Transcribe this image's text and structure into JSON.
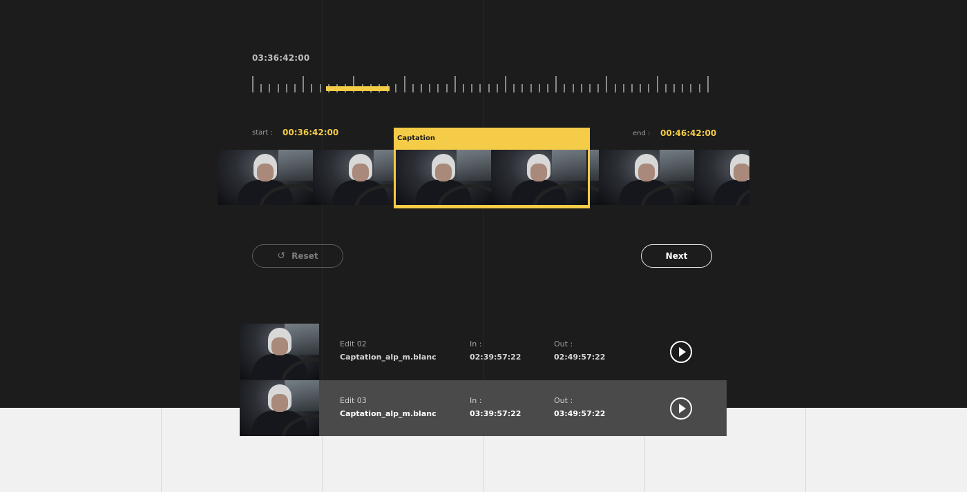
{
  "timeline": {
    "current_time": "03:36:42:00",
    "start_label": "start :",
    "start_value": "00:36:42:00",
    "end_label": "end :",
    "end_value": "00:46:42:00"
  },
  "selection": {
    "title": "Captation"
  },
  "buttons": {
    "reset_label": "Reset",
    "next_label": "Next"
  },
  "edits": [
    {
      "title": "Edit 02",
      "name": "Captation_alp_m.blanc",
      "in_label": "In :",
      "in_value": "02:39:57:22",
      "out_label": "Out :",
      "out_value": "02:49:57:22"
    },
    {
      "title": "Edit 03",
      "name": "Captation_alp_m.blanc",
      "in_label": "In :",
      "in_value": "03:39:57:22",
      "out_label": "Out :",
      "out_value": "03:49:57:22"
    }
  ],
  "icons": {
    "reset": "undo-icon",
    "play": "play-icon"
  },
  "colors": {
    "accent": "#f5cc47",
    "background_dark": "#1c1c1c",
    "background_light": "#f1f1f1",
    "selected_row": "#4a4a4a"
  }
}
